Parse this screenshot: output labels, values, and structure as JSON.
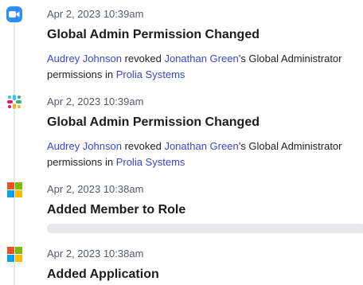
{
  "entries": [
    {
      "icon": "zoom-icon",
      "date": "Apr 2, 2023 10:39am",
      "title": "Global Admin Permission Changed",
      "actor": "Audrey Johnson",
      "verb": " revoked ",
      "target": "Jonathan Green",
      "target_suffix": "’s Global Administrator",
      "line2_prefix": "permissions in ",
      "org": "Prolia Systems"
    },
    {
      "icon": "slack-icon",
      "date": "Apr 2, 2023 10:39am",
      "title": "Global Admin Permission Changed",
      "actor": "Audrey Johnson",
      "verb": " revoked ",
      "target": "Jonathan Green",
      "target_suffix": "’s Global Administrator",
      "line2_prefix": "permissions in ",
      "org": "Prolia Systems"
    },
    {
      "icon": "microsoft-icon",
      "date": "Apr 2, 2023 10:38am",
      "title": "Added Member to Role",
      "loading_progress": 0.0
    },
    {
      "icon": "microsoft-icon",
      "date": "Apr 2, 2023 10:38am",
      "title": "Added Application"
    }
  ],
  "colors": {
    "link": "#3a46d6",
    "zoom_blue": "#2d8cff",
    "ms_red": "#f25022",
    "ms_green": "#7fba00",
    "ms_blue": "#00a4ef",
    "ms_yellow": "#ffb900"
  }
}
